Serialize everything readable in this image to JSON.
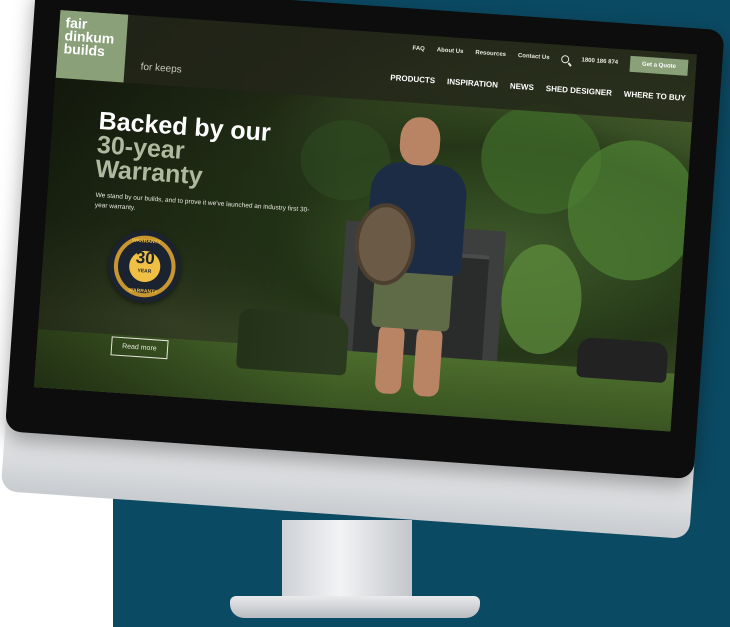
{
  "site": {
    "logo_lines": [
      "fair",
      "dinkum",
      "builds"
    ],
    "tagline": "for keeps",
    "top_nav": [
      "FAQ",
      "About Us",
      "Resources",
      "Contact Us"
    ],
    "phone": "1800 186 874",
    "cta": "Get a Quote",
    "main_nav": [
      "PRODUCTS",
      "INSPIRATION",
      "NEWS",
      "SHED DESIGNER",
      "WHERE TO BUY"
    ]
  },
  "hero": {
    "title_line1": "Backed by our",
    "title_line2": "30-year",
    "title_line3": "Warranty",
    "text": "We stand by our builds, and to prove it we've launched an industry first 30-year warranty.",
    "badge_top": "WARRANTY",
    "badge_number": "30",
    "badge_year": "YEAR",
    "badge_bottom": "WARRANTY",
    "button": "Read more"
  },
  "colors": {
    "background_panel": "#0b4a63",
    "brand_green": "#8aa079",
    "title_accent": "#aeb99f"
  }
}
